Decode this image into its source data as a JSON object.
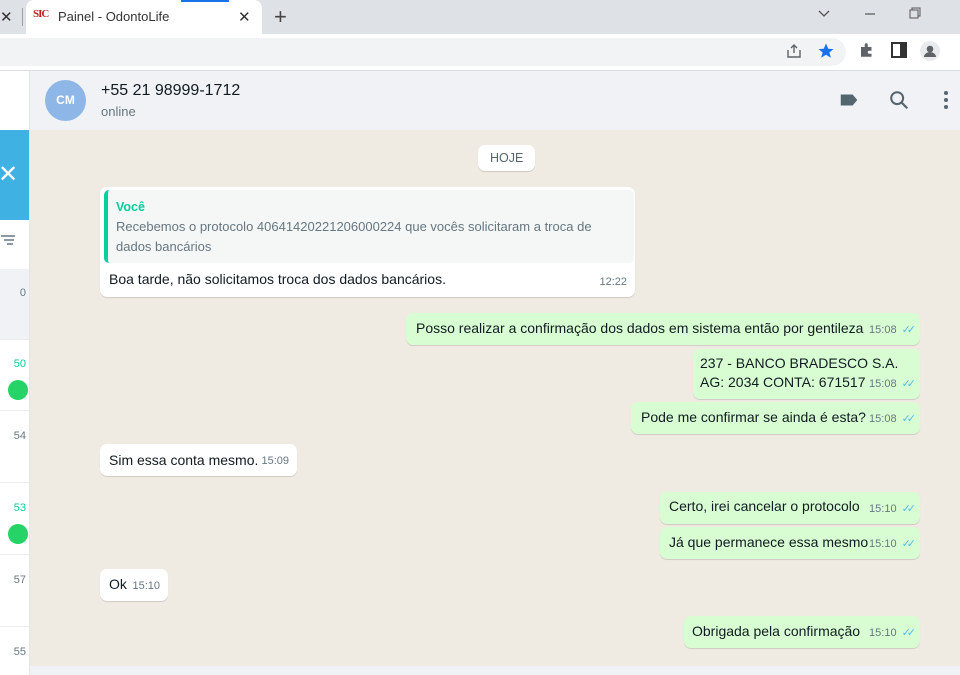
{
  "browser": {
    "tab_title": "Painel - OdontoLife",
    "favicon_text": "SIC",
    "new_tab": "+",
    "close_glyph": "✕"
  },
  "header": {
    "avatar_text": "CM",
    "contact_name": "+55 21 98999-1712",
    "contact_status": "online"
  },
  "sidebar": {
    "times": [
      "0",
      "50",
      "54",
      "53",
      "57",
      "55"
    ]
  },
  "chat": {
    "date_chip": "HOJE",
    "messages": [
      {
        "dir": "in",
        "quote_author": "Você",
        "quote_text": "Recebemos o protocolo 40641420221206000224 que vocês solicitaram a troca de dados bancários",
        "text": "Boa tarde, não solicitamos troca dos dados bancários.",
        "time": "12:22"
      },
      {
        "dir": "out",
        "text": "Posso realizar a confirmação dos dados em sistema então por gentileza",
        "time": "15:08"
      },
      {
        "dir": "out",
        "text_line1": "237 - BANCO BRADESCO S.A.",
        "text_line2": "AG: 2034  CONTA: 671517",
        "time": "15:08"
      },
      {
        "dir": "out",
        "text": "Pode me confirmar se ainda é esta?",
        "time": "15:08"
      },
      {
        "dir": "in",
        "text": "Sim essa conta mesmo.",
        "time": "15:09"
      },
      {
        "dir": "out",
        "text": "Certo, irei cancelar o protocolo",
        "time": "15:10"
      },
      {
        "dir": "out",
        "text": "Já que permanece essa mesmo",
        "time": "15:10"
      },
      {
        "dir": "in",
        "text": "Ok",
        "time": "15:10"
      },
      {
        "dir": "out",
        "text": "Obrigada pela confirmação",
        "time": "15:10"
      }
    ]
  },
  "colors": {
    "accent": "#06cf9c",
    "outgoing_bubble": "#d9fdd3",
    "chat_background": "#efeae2",
    "read_ticks": "#53bdeb"
  }
}
